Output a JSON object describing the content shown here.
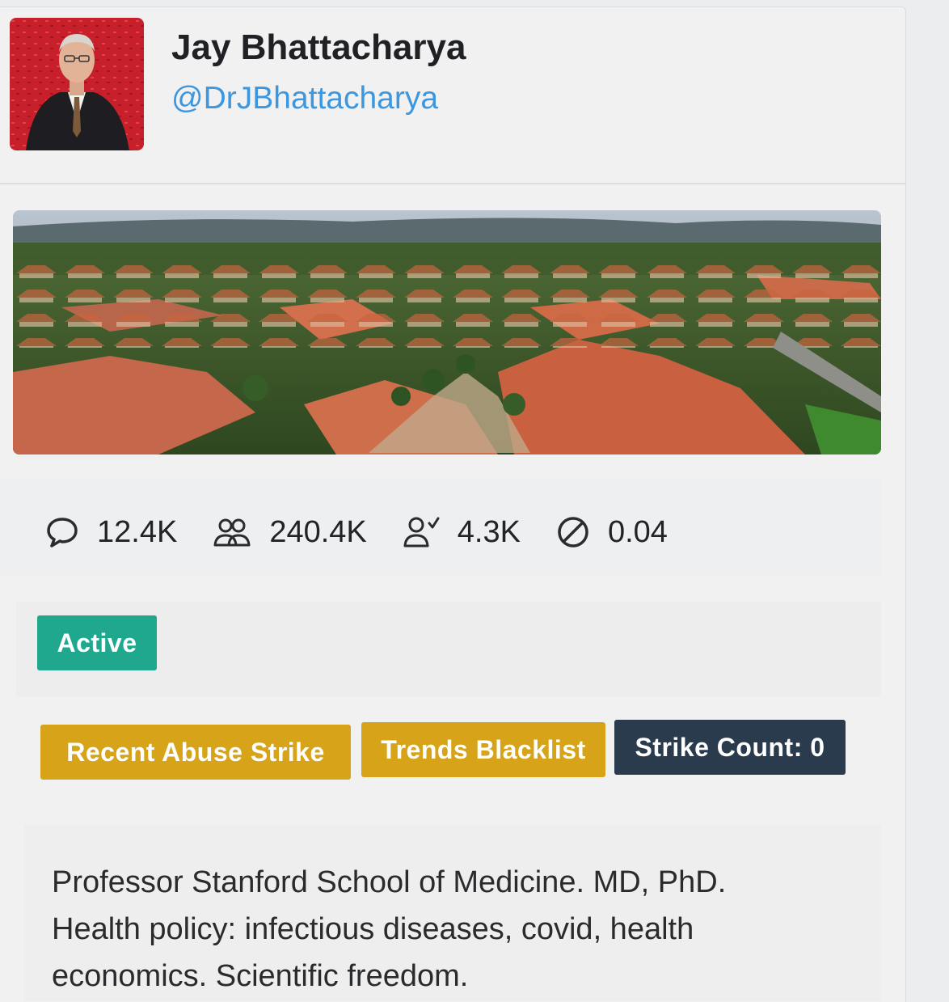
{
  "profile": {
    "name": "Jay Bhattacharya",
    "handle": "@DrJBhattacharya"
  },
  "stats": [
    {
      "icon": "comment-icon",
      "value": "12.4K"
    },
    {
      "icon": "followers-icon",
      "value": "240.4K"
    },
    {
      "icon": "following-icon",
      "value": "4.3K"
    },
    {
      "icon": "block-icon",
      "value": "0.04"
    }
  ],
  "status": {
    "label": "Active",
    "color": "#1fa88e"
  },
  "flags": {
    "abuse_strike": "Recent Abuse Strike",
    "trends_blacklist": "Trends Blacklist",
    "strike_count": "Strike Count: 0",
    "warning_color": "#d7a319",
    "dark_color": "#2a3b4e"
  },
  "bio": "Professor Stanford School of Medicine. MD, PhD. Health policy: infectious diseases, covid, health economics. Scientific freedom.",
  "colors": {
    "handle": "#3b97e0",
    "text": "#202124"
  }
}
